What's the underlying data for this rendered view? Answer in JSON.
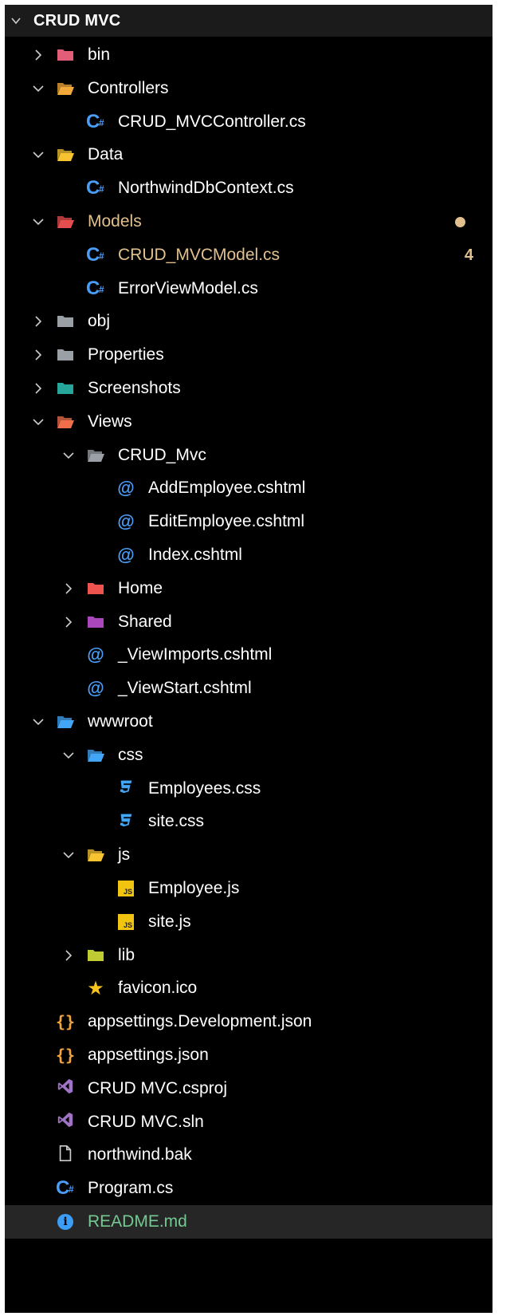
{
  "explorer": {
    "title": "CRUD MVC",
    "status_colors": {
      "modified": "#e2c08d",
      "info": "#73c991"
    },
    "tree": [
      {
        "label": "bin",
        "depth": 0,
        "kind": "folder",
        "state": "collapsed",
        "icon": "bin-folder-icon",
        "color": "#e25d78"
      },
      {
        "label": "Controllers",
        "depth": 0,
        "kind": "folder",
        "state": "expanded",
        "icon": "controllers-folder-icon",
        "color": "#f1a93a"
      },
      {
        "label": "CRUD_MVCController.cs",
        "depth": 1,
        "kind": "file",
        "icon": "csharp-icon"
      },
      {
        "label": "Data",
        "depth": 0,
        "kind": "folder",
        "state": "expanded",
        "icon": "data-folder-icon",
        "color": "#f7c331"
      },
      {
        "label": "NorthwindDbContext.cs",
        "depth": 1,
        "kind": "file",
        "icon": "csharp-icon"
      },
      {
        "label": "Models",
        "depth": 0,
        "kind": "folder",
        "state": "expanded",
        "icon": "models-folder-icon",
        "color": "#e54e4e",
        "status": "modified",
        "badge": "dot"
      },
      {
        "label": "CRUD_MVCModel.cs",
        "depth": 1,
        "kind": "file",
        "icon": "csharp-icon",
        "status": "modified",
        "badge": "4"
      },
      {
        "label": "ErrorViewModel.cs",
        "depth": 1,
        "kind": "file",
        "icon": "csharp-icon"
      },
      {
        "label": "obj",
        "depth": 0,
        "kind": "folder",
        "state": "collapsed",
        "icon": "folder-icon",
        "color": "#9aa0a6"
      },
      {
        "label": "Properties",
        "depth": 0,
        "kind": "folder",
        "state": "collapsed",
        "icon": "folder-icon",
        "color": "#9aa0a6"
      },
      {
        "label": "Screenshots",
        "depth": 0,
        "kind": "folder",
        "state": "collapsed",
        "icon": "images-folder-icon",
        "color": "#26a69a"
      },
      {
        "label": "Views",
        "depth": 0,
        "kind": "folder",
        "state": "expanded",
        "icon": "views-folder-icon",
        "color": "#f06f4a"
      },
      {
        "label": "CRUD_Mvc",
        "depth": 1,
        "kind": "folder",
        "state": "expanded",
        "icon": "open-folder-icon",
        "color": "#9aa0a6"
      },
      {
        "label": "AddEmployee.cshtml",
        "depth": 2,
        "kind": "file",
        "icon": "razor-icon"
      },
      {
        "label": "EditEmployee.cshtml",
        "depth": 2,
        "kind": "file",
        "icon": "razor-icon"
      },
      {
        "label": "Index.cshtml",
        "depth": 2,
        "kind": "file",
        "icon": "razor-icon"
      },
      {
        "label": "Home",
        "depth": 1,
        "kind": "folder",
        "state": "collapsed",
        "icon": "home-folder-icon",
        "color": "#ef5350"
      },
      {
        "label": "Shared",
        "depth": 1,
        "kind": "folder",
        "state": "collapsed",
        "icon": "shared-folder-icon",
        "color": "#ab47bc"
      },
      {
        "label": "_ViewImports.cshtml",
        "depth": 1,
        "kind": "file",
        "icon": "razor-icon"
      },
      {
        "label": "_ViewStart.cshtml",
        "depth": 1,
        "kind": "file",
        "icon": "razor-icon"
      },
      {
        "label": "wwwroot",
        "depth": 0,
        "kind": "folder",
        "state": "expanded",
        "icon": "web-folder-icon",
        "color": "#42a5f5"
      },
      {
        "label": "css",
        "depth": 1,
        "kind": "folder",
        "state": "expanded",
        "icon": "css-folder-icon",
        "color": "#42a5f5"
      },
      {
        "label": "Employees.css",
        "depth": 2,
        "kind": "file",
        "icon": "css-icon"
      },
      {
        "label": "site.css",
        "depth": 2,
        "kind": "file",
        "icon": "css-icon"
      },
      {
        "label": "js",
        "depth": 1,
        "kind": "folder",
        "state": "expanded",
        "icon": "js-folder-icon",
        "color": "#f7c331"
      },
      {
        "label": "Employee.js",
        "depth": 2,
        "kind": "file",
        "icon": "js-icon"
      },
      {
        "label": "site.js",
        "depth": 2,
        "kind": "file",
        "icon": "js-icon"
      },
      {
        "label": "lib",
        "depth": 1,
        "kind": "folder",
        "state": "collapsed",
        "icon": "lib-folder-icon",
        "color": "#c0ca33"
      },
      {
        "label": "favicon.ico",
        "depth": 1,
        "kind": "file",
        "icon": "star-icon"
      },
      {
        "label": "appsettings.Development.json",
        "depth": 0,
        "kind": "file",
        "icon": "json-icon"
      },
      {
        "label": "appsettings.json",
        "depth": 0,
        "kind": "file",
        "icon": "json-icon"
      },
      {
        "label": "CRUD MVC.csproj",
        "depth": 0,
        "kind": "file",
        "icon": "visual-studio-icon"
      },
      {
        "label": "CRUD MVC.sln",
        "depth": 0,
        "kind": "file",
        "icon": "visual-studio-icon"
      },
      {
        "label": "northwind.bak",
        "depth": 0,
        "kind": "file",
        "icon": "file-icon"
      },
      {
        "label": "Program.cs",
        "depth": 0,
        "kind": "file",
        "icon": "csharp-icon"
      },
      {
        "label": "README.md",
        "depth": 0,
        "kind": "file",
        "icon": "info-icon",
        "status": "info",
        "selected": true
      }
    ]
  }
}
